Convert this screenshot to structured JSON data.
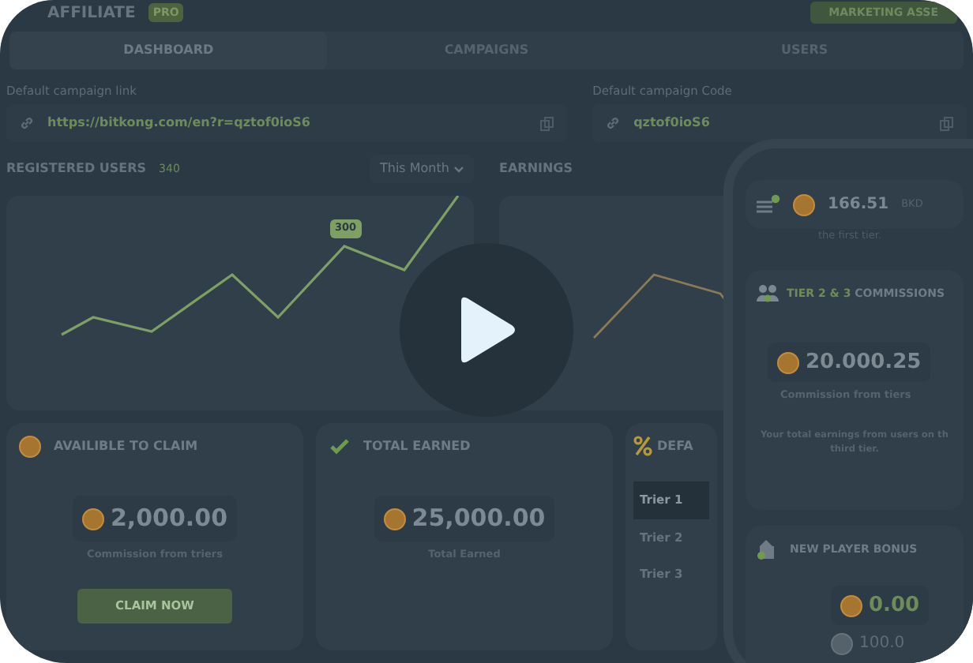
{
  "header": {
    "title": "AFFILIATE",
    "badge": "PRO",
    "button": "MARKETING ASSE"
  },
  "tabs": [
    {
      "label": "DASHBOARD",
      "selected": true
    },
    {
      "label": "CAMPAIGNS",
      "selected": false
    },
    {
      "label": "USERS",
      "selected": false
    }
  ],
  "fields": [
    {
      "label": "Default campaign link",
      "value": "https://bitkong.com/en?r=qztof0ioS6"
    },
    {
      "label": "Default campaign Code",
      "value": "qztof0ioS6"
    }
  ],
  "registered_users": {
    "title": "REGISTERED USERS",
    "count": "340",
    "period": "This Month",
    "tooltip": "300"
  },
  "earnings": {
    "title": "EARNINGS"
  },
  "cards": [
    {
      "kind": "claim",
      "title": "AVAILIBLE TO CLAIM",
      "amount": "2,000.00",
      "caption": "Commission from triers",
      "button": "CLAIM NOW"
    },
    {
      "kind": "earned",
      "title": "TOTAL EARNED",
      "amount": "25,000.00",
      "caption": "Total Earned"
    },
    {
      "kind": "tiers",
      "title": "DEFA",
      "rows": [
        {
          "label": "Trier 1",
          "selected": true
        },
        {
          "label": "Trier 2",
          "selected": false
        },
        {
          "label": "Trier 3",
          "selected": false
        }
      ]
    }
  ],
  "phone": {
    "balance": "166.51",
    "currency": "BKD",
    "fragment": "the first tier.",
    "tier_card": {
      "highlight": "TIER 2 & 3",
      "title": "COMMISSIONS",
      "amount": "20.000.25",
      "caption": "Commission from tiers",
      "note": "Your total earnings from users on th\nthird tier."
    },
    "bonus": {
      "title": "NEW PLAYER BONUS",
      "amount": "0.00",
      "secondary": "100.0"
    }
  }
}
